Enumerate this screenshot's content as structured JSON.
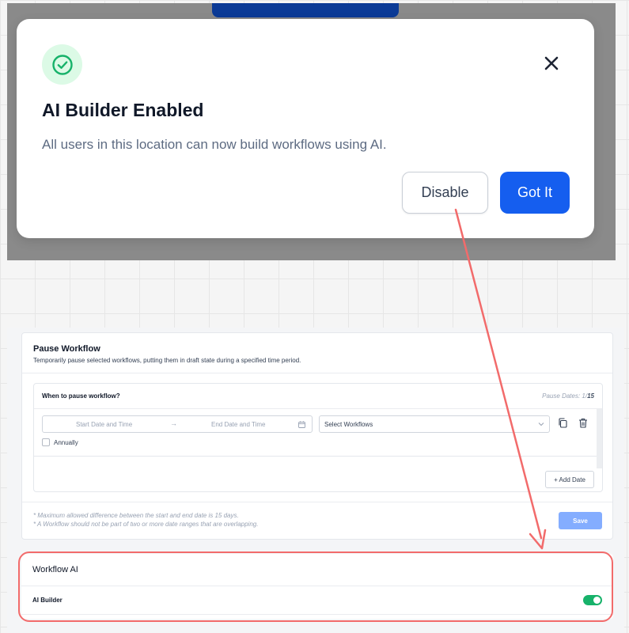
{
  "modal": {
    "title": "AI Builder Enabled",
    "description": "All users in this location can now build workflows using AI.",
    "disable_label": "Disable",
    "got_it_label": "Got It",
    "close_icon": "close-icon",
    "status_icon": "check-circle-icon"
  },
  "pause_workflow": {
    "title": "Pause Workflow",
    "subtitle": "Temporarily pause selected workflows, putting them in draft state during a specified time period.",
    "panel_title": "When to pause workflow?",
    "pause_dates_label": "Pause Dates: 1/",
    "pause_dates_max": "15",
    "start_placeholder": "Start Date and Time",
    "arrow": "→",
    "end_placeholder": "End Date and Time",
    "select_placeholder": "Select Workflows",
    "annually_label": "Annually",
    "add_date_label": "+ Add Date",
    "note_1": "* Maximum allowed difference between the start and end date is 15 days.",
    "note_2": "* A Workflow should not be part of two or more date ranges that are overlapping.",
    "save_label": "Save"
  },
  "workflow_ai": {
    "title": "Workflow AI",
    "ai_builder_label": "AI Builder",
    "ai_builder_enabled": true
  },
  "colors": {
    "primary": "#155eef",
    "success": "#17b26a",
    "annotation": "#f26b6b"
  }
}
